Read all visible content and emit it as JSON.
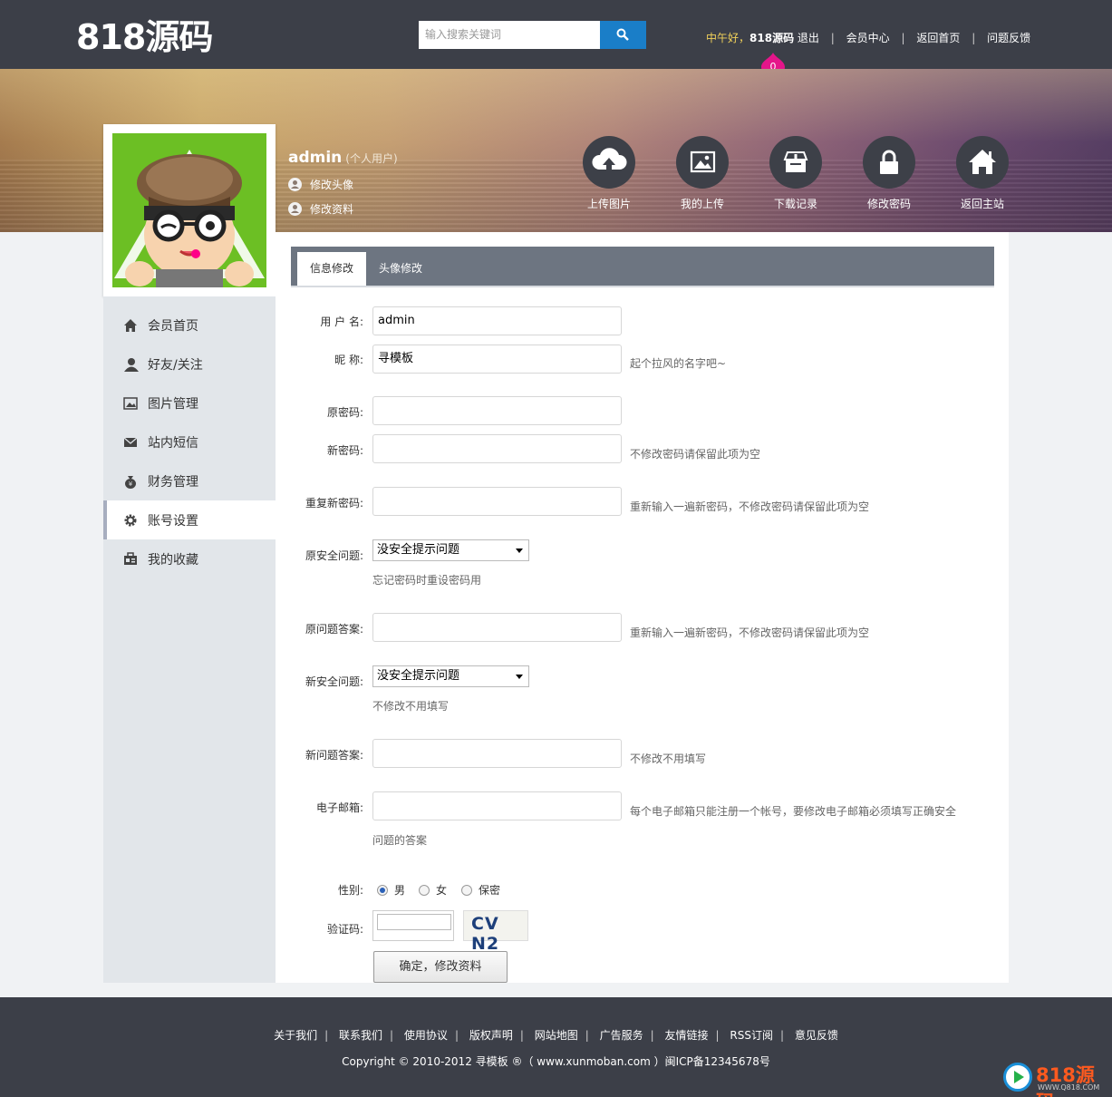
{
  "header": {
    "logo": "818源码",
    "search_placeholder": "输入搜索关键词",
    "greeting": "中午好，",
    "username": "818源码",
    "logout": "退出",
    "links": [
      "会员中心",
      "返回首页",
      "问题反馈"
    ],
    "notification_count": "0"
  },
  "profile": {
    "name": "admin",
    "type": "(个人用户)",
    "edit_avatar": "修改头像",
    "edit_info": "修改资料"
  },
  "quick_actions": [
    {
      "label": "上传图片",
      "icon": "cloud-upload-icon"
    },
    {
      "label": "我的上传",
      "icon": "image-icon"
    },
    {
      "label": "下载记录",
      "icon": "download-box-icon"
    },
    {
      "label": "修改密码",
      "icon": "lock-icon"
    },
    {
      "label": "返回主站",
      "icon": "home-icon"
    }
  ],
  "sidebar": {
    "items": [
      {
        "label": "会员首页",
        "icon": "home-icon"
      },
      {
        "label": "好友/关注",
        "icon": "user-icon"
      },
      {
        "label": "图片管理",
        "icon": "picture-icon"
      },
      {
        "label": "站内短信",
        "icon": "envelope-icon"
      },
      {
        "label": "财务管理",
        "icon": "money-bag-icon"
      },
      {
        "label": "账号设置",
        "icon": "gear-icon",
        "active": true
      },
      {
        "label": "我的收藏",
        "icon": "favorite-icon"
      }
    ]
  },
  "tabs": [
    "信息修改",
    "头像修改"
  ],
  "form": {
    "username_label": "用 户 名:",
    "username_value": "admin",
    "nickname_label": "昵 称:",
    "nickname_value": "寻模板",
    "nickname_hint": "起个拉风的名字吧~",
    "old_password_label": "原密码:",
    "new_password_label": "新密码:",
    "new_password_hint": "不修改密码请保留此项为空",
    "repeat_password_label": "重复新密码:",
    "repeat_password_hint": "重新输入一遍新密码，不修改密码请保留此项为空",
    "old_question_label": "原安全问题:",
    "old_question_value": "没安全提示问题",
    "old_question_hint": "忘记密码时重设密码用",
    "old_answer_label": "原问题答案:",
    "old_answer_hint": "重新输入一遍新密码，不修改密码请保留此项为空",
    "new_question_label": "新安全问题:",
    "new_question_value": "没安全提示问题",
    "new_question_hint": "不修改不用填写",
    "new_answer_label": "新问题答案:",
    "new_answer_hint": "不修改不用填写",
    "email_label": "电子邮箱:",
    "email_hint_1": "每个电子邮箱只能注册一个帐号，要修改电子邮箱必须填写正确安全",
    "email_hint_2": "问题的答案",
    "gender_label": "性别:",
    "gender_options": [
      "男",
      "女",
      "保密"
    ],
    "gender_selected": "男",
    "captcha_label": "验证码:",
    "captcha_text": "CV N2",
    "submit": "确定，修改资料"
  },
  "footer": {
    "links": [
      "关于我们",
      "联系我们",
      "使用协议",
      "版权声明",
      "网站地图",
      "广告服务",
      "友情链接",
      "RSS订阅",
      "意见反馈"
    ],
    "copyright": "Copyright © 2010-2012 寻模板 ®（ www.xunmoban.com ）闽ICP备12345678号"
  },
  "watermark": {
    "text": "818源码",
    "sub": "WWW.Q818.COM"
  },
  "colors": {
    "header_bg": "#3c3f48",
    "search_button": "#1a7ec8",
    "badge": "#e5158a",
    "greeting": "#f2d25a",
    "tabbar": "#6d7581",
    "sidebar_bg": "#e2e6ea"
  }
}
